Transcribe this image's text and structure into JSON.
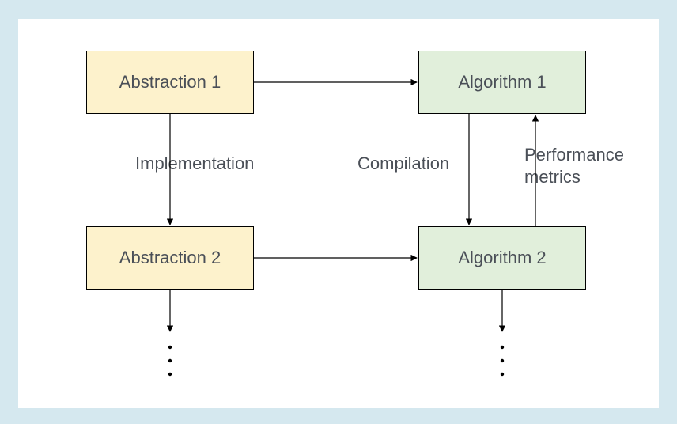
{
  "nodes": {
    "abstraction1": "Abstraction 1",
    "abstraction2": "Abstraction 2",
    "algorithm1": "Algorithm 1",
    "algorithm2": "Algorithm 2"
  },
  "edges": {
    "implementation": "Implementation",
    "compilation": "Compilation",
    "performance": "Performance\nmetrics"
  }
}
